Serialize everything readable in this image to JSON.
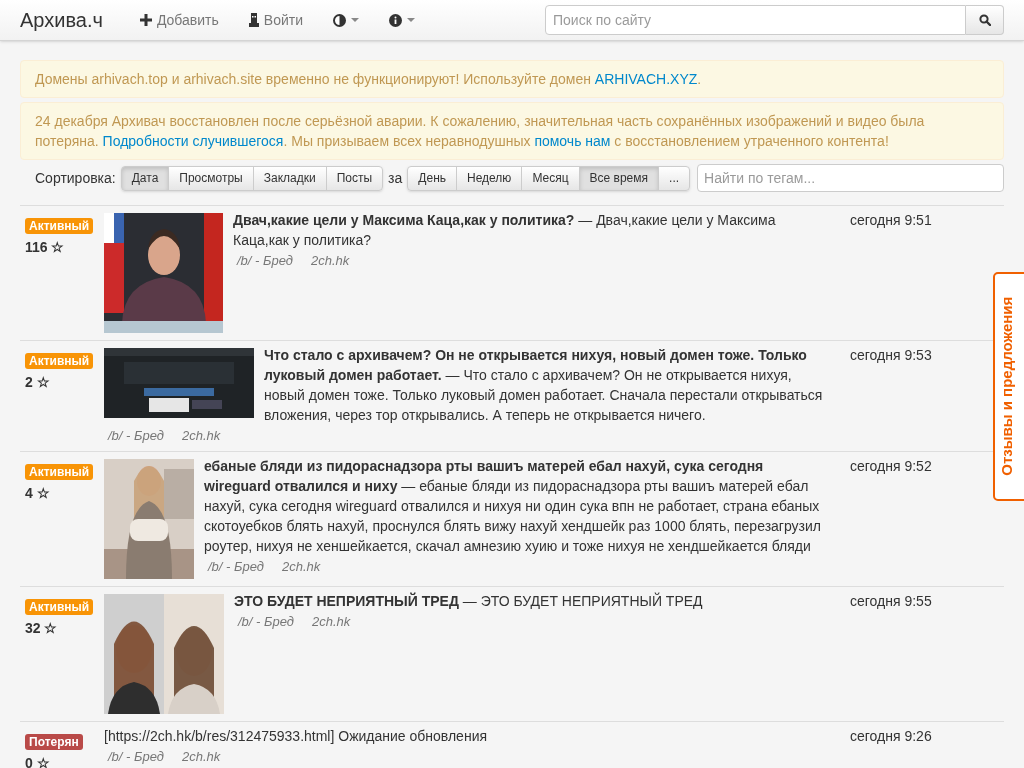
{
  "navbar": {
    "brand": "Архива.ч",
    "items": [
      {
        "kind": "plus",
        "label": "Добавить"
      },
      {
        "kind": "login",
        "label": "Войти"
      },
      {
        "kind": "contrast",
        "dropdown": true
      },
      {
        "kind": "info",
        "dropdown": true
      }
    ],
    "search": {
      "placeholder": "Поиск по сайту"
    }
  },
  "alerts": [
    {
      "segments": [
        {
          "text": "Домены arhivach.top и arhivach.site временно не функционируют! Используйте домен "
        },
        {
          "link": "ARHIVACH.XYZ"
        },
        {
          "text": "."
        }
      ]
    },
    {
      "segments": [
        {
          "text": "24 декабря Архивач восстановлен после серьёзной аварии. К сожалению, значительная часть сохранённых изображений и видео была потеряна. "
        },
        {
          "link": "Подробности случившегося"
        },
        {
          "text": ". Мы призываем всех неравнодушных "
        },
        {
          "link": "помочь нам"
        },
        {
          "text": " с восстановлением утраченного контента!"
        }
      ]
    }
  ],
  "sort": {
    "label": "Сортировка:",
    "options": [
      {
        "label": "Дата",
        "selected": true
      },
      {
        "label": "Просмотры",
        "selected": false
      },
      {
        "label": "Закладки",
        "selected": false
      },
      {
        "label": "Посты",
        "selected": false
      }
    ],
    "period_label": "за",
    "periods": [
      {
        "label": "День",
        "selected": false
      },
      {
        "label": "Неделю",
        "selected": false
      },
      {
        "label": "Месяц",
        "selected": false
      },
      {
        "label": "Все время",
        "selected": true
      },
      {
        "label": "...",
        "selected": false
      }
    ],
    "tag_search": {
      "placeholder": "Найти по тегам..."
    }
  },
  "threads": [
    {
      "status": {
        "label": "Активный",
        "kind": "active"
      },
      "score": "116 ☆",
      "text": "**Двач,какие цели у Максима Каца,как у политика?** — Двач,какие цели у Максима Каца,как у политика?",
      "board": "/b/ - Бред",
      "site": "2ch.hk",
      "time": "сегодня 9:51"
    },
    {
      "status": {
        "label": "Активный",
        "kind": "active"
      },
      "score": "2 ☆",
      "text": "**Что стало с архивачем? Он не открывается нихуя, новый домен тоже. Только луковый домен работает.** — Что стало с архивачем? Он не открывается нихуя, новый домен тоже. Только луковый домен работает. Сначала перестали открываться вложения, через тор открывались. А теперь не открывается ничего.",
      "board": "/b/ - Бред",
      "site": "2ch.hk",
      "time": "сегодня 9:53"
    },
    {
      "status": {
        "label": "Активный",
        "kind": "active"
      },
      "score": "4 ☆",
      "text": "**ебаные бляди из пидораснадзора рты вашиъ матерей ебал нахуй, сука сегодня wireguard отвалился и ниху** — ебаные бляди из пидораснадзора рты вашиъ матерей ебал нахуй, сука сегодня wireguard отвалился и нихуя ни один сука впн не работает, страна ебаных скотоуебков блять нахуй, проснулся блять вижу нахуй хендшейк раз 1000 блять, перезагрузил роутер, нихуя не хеншейкается, скачал амнезию хуию и тоже нихуя не хендшейкается бляди",
      "board": "/b/ - Бред",
      "site": "2ch.hk",
      "time": "сегодня 9:52"
    },
    {
      "status": {
        "label": "Активный",
        "kind": "active"
      },
      "score": "32 ☆",
      "text": "**ЭТО БУДЕТ НЕПРИЯТНЫЙ ТРЕД** — ЭТО БУДЕТ НЕПРИЯТНЫЙ ТРЕД",
      "board": "/b/ - Бред",
      "site": "2ch.hk",
      "time": "сегодня 9:55"
    },
    {
      "status": {
        "label": "Потерян",
        "kind": "lost"
      },
      "score": "0 ☆",
      "text": "[https://2ch.hk/b/res/312475933.html] Ожидание обновления",
      "board": "/b/ - Бред",
      "site": "2ch.hk",
      "time": "сегодня 9:26"
    }
  ],
  "feedback_tab": {
    "label": "Отзывы и предложения"
  }
}
